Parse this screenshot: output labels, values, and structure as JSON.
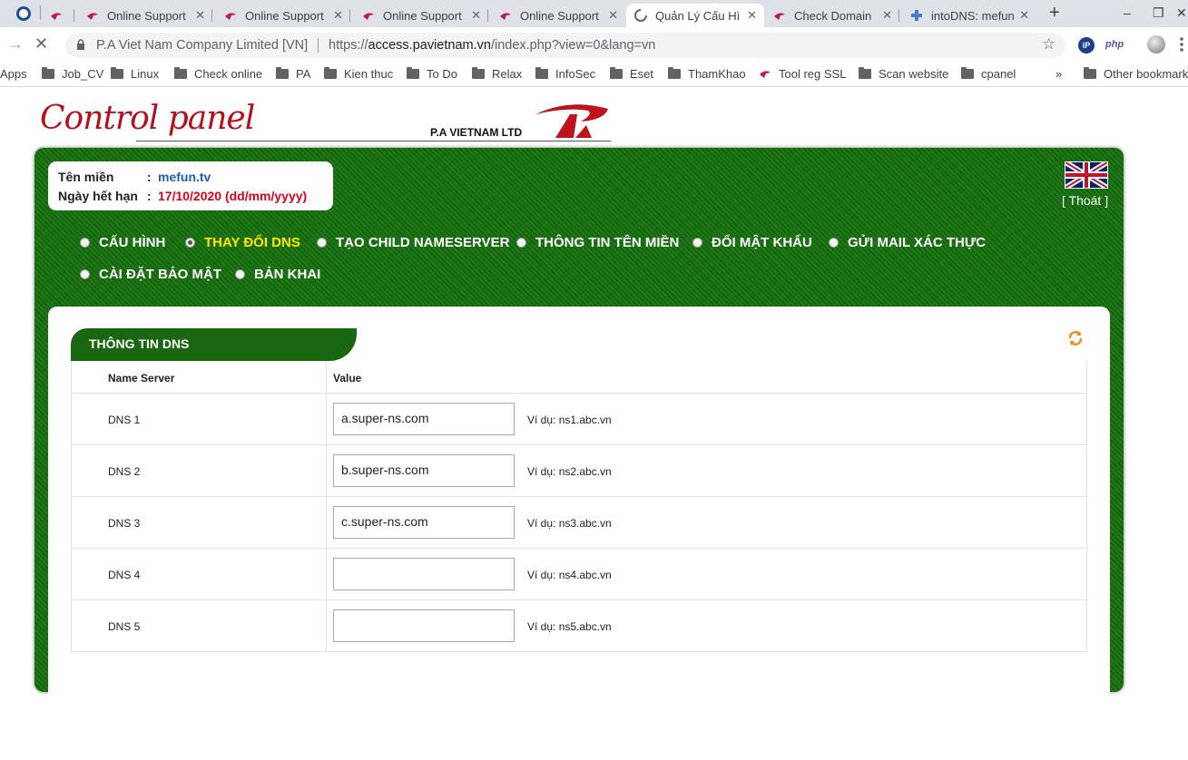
{
  "browser": {
    "tabs": [
      {
        "label": "Online Support"
      },
      {
        "label": "Online Support"
      },
      {
        "label": "Online Support"
      },
      {
        "label": "Online Support"
      },
      {
        "label": "Quản Lý Cấu Hì"
      },
      {
        "label": "Check Domain"
      },
      {
        "label": "intoDNS: mefun"
      }
    ],
    "new_tab": "+",
    "window": {
      "minimize": "–",
      "maximize": "❐",
      "close": "✕"
    },
    "page_title": "P.A Viet Nam Company Limited [VN]",
    "url_prefix": "https://",
    "url_host": "access.pavietnam.vn",
    "url_path": "/index.php?view=0&lang=vn",
    "ext_php": "php"
  },
  "bookmarks": {
    "apps": "Apps",
    "items": [
      "Job_CV",
      "Linux",
      "Check online",
      "PA",
      "Kien thuc",
      "To Do",
      "Relax",
      "InfoSec",
      "Eset",
      "ThamKhao",
      "Tool reg SSL",
      "Scan website",
      "cpanel"
    ],
    "more": "»",
    "other": "Other bookmarks"
  },
  "header": {
    "logo": "Control panel",
    "company": "P.A VIETNAM LTD"
  },
  "info": {
    "domain_label": "Tên miền",
    "domain_value": "mefun.tv",
    "expiry_label": "Ngày hết hạn",
    "expiry_value": "17/10/2020 (dd/mm/yyyy)",
    "colon": ":"
  },
  "logout": "[ Thoát ]",
  "menu": [
    {
      "label": "CẤU HÌNH",
      "active": false
    },
    {
      "label": "THAY ĐỔI DNS",
      "active": true
    },
    {
      "label": "TẠO CHILD NAMESERVER",
      "active": false
    },
    {
      "label": "THÔNG TIN TÊN MIỀN",
      "active": false
    },
    {
      "label": "ĐỔI MẬT KHẨU",
      "active": false
    },
    {
      "label": "GỬI MAIL XÁC THỰC",
      "active": false
    },
    {
      "label": "CÀI ĐẶT BẢO MẬT",
      "active": false
    },
    {
      "label": "BẢN KHAI",
      "active": false
    }
  ],
  "dns_section": {
    "title": "THÔNG TIN DNS",
    "col_name": "Name Server",
    "col_value": "Value",
    "rows": [
      {
        "label": "DNS 1",
        "value": "a.super-ns.com",
        "hint": "Ví dụ: ns1.abc.vn"
      },
      {
        "label": "DNS 2",
        "value": "b.super-ns.com",
        "hint": "Ví dụ: ns2.abc.vn"
      },
      {
        "label": "DNS 3",
        "value": "c.super-ns.com",
        "hint": "Ví dụ: ns3.abc.vn"
      },
      {
        "label": "DNS 4",
        "value": "",
        "hint": "Ví dụ: ns4.abc.vn"
      },
      {
        "label": "DNS 5",
        "value": "",
        "hint": "Ví dụ: ns5.abc.vn"
      }
    ]
  },
  "colors": {
    "panel_green": "#1f7a16",
    "active_menu": "#ffe400",
    "brand_red": "#b3121a",
    "expiry_red": "#e0001b",
    "domain_blue": "#1b5fb3"
  }
}
